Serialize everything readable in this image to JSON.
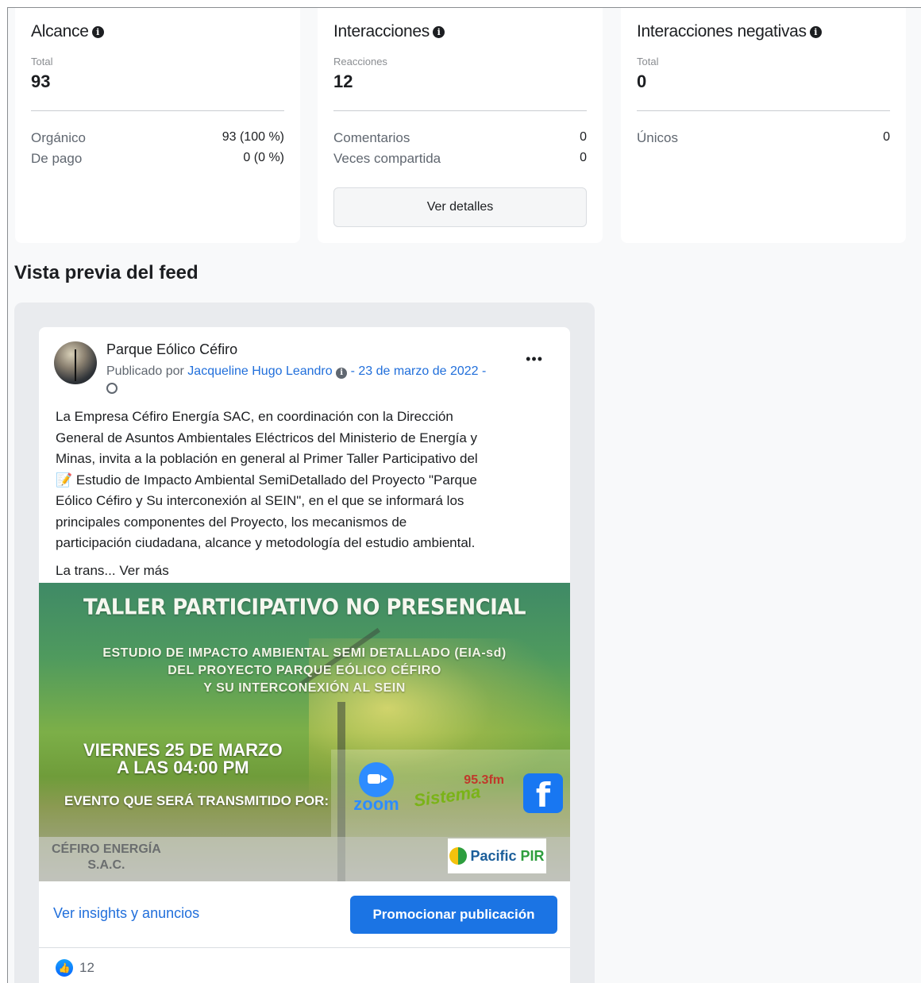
{
  "cards": [
    {
      "title": "Alcance",
      "sub_label": "Total",
      "value": "93",
      "rows": [
        {
          "label": "Orgánico",
          "value": "93 (100 %)"
        },
        {
          "label": "De pago",
          "value": "0 (0 %)"
        }
      ]
    },
    {
      "title": "Interacciones",
      "sub_label": "Reacciones",
      "value": "12",
      "rows": [
        {
          "label": "Comentarios",
          "value": "0"
        },
        {
          "label": "Veces compartida",
          "value": "0"
        }
      ],
      "button": "Ver detalles"
    },
    {
      "title": "Interacciones negativas",
      "sub_label": "Total",
      "value": "0",
      "rows": [
        {
          "label": "Únicos",
          "value": "0"
        }
      ]
    }
  ],
  "section_title": "Vista previa del feed",
  "post": {
    "page_name": "Parque Eólico Céfiro",
    "published_by_prefix": "Publicado por",
    "author": "Jacqueline Hugo Leandro",
    "date": "- 23 de marzo de 2022 -",
    "body": "La Empresa Céfiro Energía SAC, en coordinación con la Dirección\nGeneral de Asuntos Ambientales Eléctricos del Ministerio de Energía y\nMinas, invita a la población en general al Primer Taller Participativo del\n📝 Estudio de Impacto Ambiental SemiDetallado del Proyecto \"Parque\nEólico Céfiro y Su interconexión al SEIN\", en el que se informará los\nprincipales componentes del Proyecto, los mecanismos de\nparticipación ciudadana, alcance y metodología del estudio ambiental.",
    "truncated": "La trans...",
    "see_more": "Ver más",
    "image": {
      "heading": "TALLER PARTICIPATIVO NO PRESENCIAL",
      "subheading": "ESTUDIO DE IMPACTO AMBIENTAL SEMI DETALLADO (EIA-sd)\nDEL PROYECTO PARQUE EÓLICO CÉFIRO\nY SU INTERCONEXIÓN AL SEIN",
      "date": "VIERNES 25 DE MARZO\nA LAS 04:00 PM",
      "event": "EVENTO QUE SERÁ TRANSMITIDO POR:",
      "zoom": "zoom",
      "radio_freq": "95.3fm",
      "radio_name": "Sistema",
      "company": "CÉFIRO ENERGÍA\nS.A.C.",
      "pacific": "Pacific",
      "pacific_suffix": "PIR"
    },
    "insights_link": "Ver insights y anuncios",
    "promote_button": "Promocionar publicación",
    "reaction_count": "12"
  }
}
